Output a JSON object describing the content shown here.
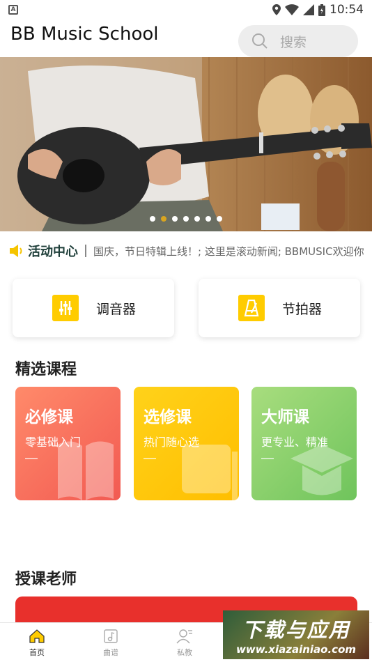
{
  "status_bar": {
    "time": "10:54"
  },
  "header": {
    "title": "BB Music School",
    "search_placeholder": "搜索"
  },
  "banner": {
    "dot_count": 7,
    "active_dot": 1
  },
  "notice": {
    "title": "活动中心",
    "text": "国庆，节日特辑上线！; 这里是滚动新闻; BBMUSIC欢迎你"
  },
  "tools": [
    {
      "label": "调音器",
      "icon": "tuner-icon"
    },
    {
      "label": "节拍器",
      "icon": "metronome-icon"
    }
  ],
  "courses_section": {
    "title": "精选课程"
  },
  "courses": [
    {
      "title": "必修课",
      "subtitle": "零基础入门",
      "color_from": "#ff8a6a",
      "color_to": "#f25a52",
      "icon": "book-open-icon"
    },
    {
      "title": "选修课",
      "subtitle": "热门随心选",
      "color_from": "#ffd21a",
      "color_to": "#ffbe00",
      "icon": "book-icon"
    },
    {
      "title": "大师课",
      "subtitle": "更专业、精准",
      "color_from": "#a8dd7e",
      "color_to": "#6fc45c",
      "icon": "graduation-cap-icon"
    }
  ],
  "teachers_section": {
    "title": "授课老师"
  },
  "tabbar": [
    {
      "label": "首页",
      "icon": "home-icon",
      "active": true
    },
    {
      "label": "曲谱",
      "icon": "sheet-music-icon",
      "active": false
    },
    {
      "label": "私教",
      "icon": "tutor-icon",
      "active": false
    }
  ],
  "watermark": {
    "big": "下载与应用",
    "small": "www.xiazainiao.com"
  }
}
